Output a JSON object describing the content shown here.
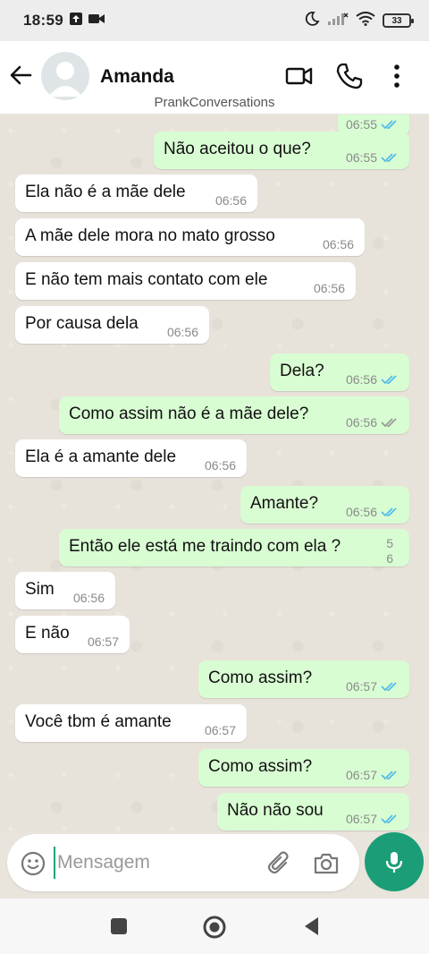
{
  "status_bar": {
    "time": "18:59",
    "battery": "33"
  },
  "header": {
    "contact_name": "Amanda",
    "watermark": "PrankConversations"
  },
  "messages": [
    {
      "dir": "out",
      "text": "",
      "time": "06:55",
      "ticks": "read"
    },
    {
      "dir": "out",
      "text": "Não aceitou o que?",
      "time": "06:55",
      "ticks": "read"
    },
    {
      "dir": "in",
      "text": "Ela não é a mãe dele",
      "time": "06:56"
    },
    {
      "dir": "in",
      "text": "A mãe dele mora no mato grosso",
      "time": "06:56"
    },
    {
      "dir": "in",
      "text": "E não tem mais contato com ele",
      "time": "06:56"
    },
    {
      "dir": "in",
      "text": "Por causa dela",
      "time": "06:56"
    },
    {
      "dir": "out",
      "text": "Dela?",
      "time": "06:56",
      "ticks": "read"
    },
    {
      "dir": "out",
      "text": "Como assim não é a mãe dele?",
      "time": "06:56",
      "ticks": "sent"
    },
    {
      "dir": "in",
      "text": "Ela é a amante dele",
      "time": "06:56"
    },
    {
      "dir": "out",
      "text": "Amante?",
      "time": "06:56",
      "ticks": "read"
    },
    {
      "dir": "out",
      "text": "Então ele está me traindo com ela ?",
      "time_a": "5",
      "time_b": "6"
    },
    {
      "dir": "in",
      "text": "Sim",
      "time": "06:56"
    },
    {
      "dir": "in",
      "text": "E não",
      "time": "06:57"
    },
    {
      "dir": "out",
      "text": "Como assim?",
      "time": "06:57",
      "ticks": "read"
    },
    {
      "dir": "in",
      "text": "Você tbm é amante",
      "time": "06:57"
    },
    {
      "dir": "out",
      "text": "Como assim?",
      "time": "06:57",
      "ticks": "read"
    },
    {
      "dir": "out",
      "text": "Não não sou",
      "time": "06:57",
      "ticks": "read"
    }
  ],
  "composer": {
    "placeholder": "Mensagem"
  },
  "colors": {
    "accent": "#1b9e77",
    "outgoing_bubble": "#d9fdd3",
    "incoming_bubble": "#ffffff",
    "read_tick": "#53bdeb"
  }
}
